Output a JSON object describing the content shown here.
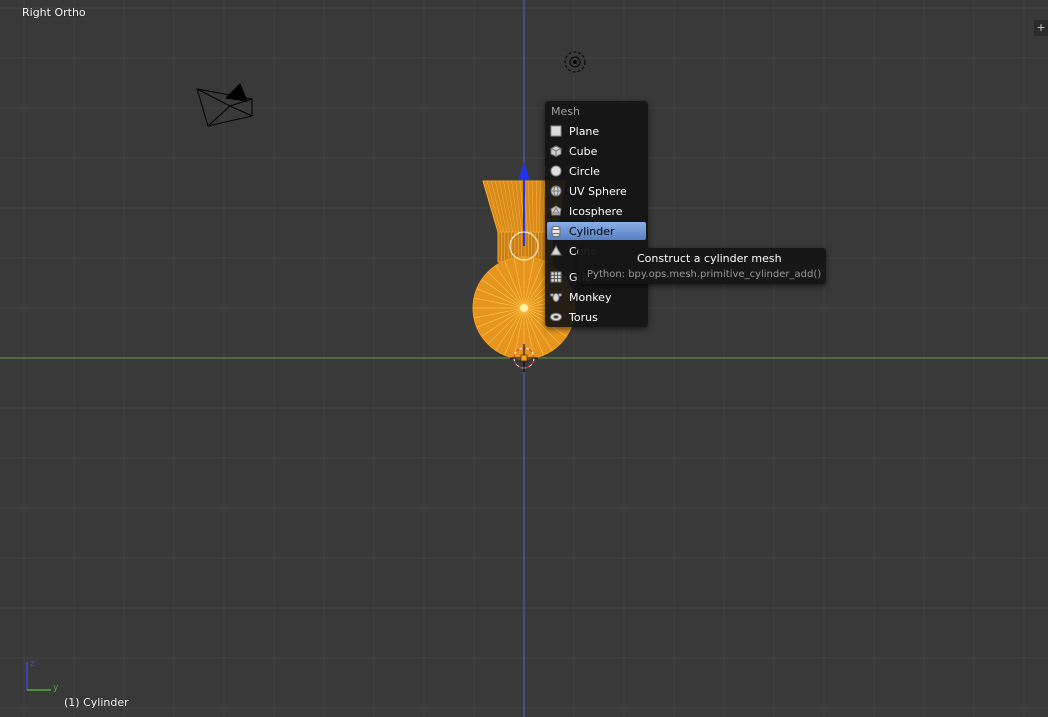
{
  "viewport": {
    "view_label": "Right Ortho",
    "object_info": "(1) Cylinder",
    "corner_widget": "+",
    "axis_labels": {
      "y": "y",
      "z": "z"
    }
  },
  "menu": {
    "title": "Mesh",
    "items": [
      {
        "label": "Plane",
        "icon": "plane-icon",
        "active": false
      },
      {
        "label": "Cube",
        "icon": "cube-icon",
        "active": false
      },
      {
        "label": "Circle",
        "icon": "circle-icon",
        "active": false
      },
      {
        "label": "UV Sphere",
        "icon": "uv-sphere-icon",
        "active": false
      },
      {
        "label": "Icosphere",
        "icon": "icosphere-icon",
        "active": false
      },
      {
        "label": "Cylinder",
        "icon": "cylinder-icon",
        "active": true
      },
      {
        "label": "Cone",
        "icon": "cone-icon",
        "active": false
      },
      {
        "label": "Grid",
        "icon": "grid-icon",
        "active": false
      },
      {
        "label": "Monkey",
        "icon": "monkey-icon",
        "active": false
      },
      {
        "label": "Torus",
        "icon": "torus-icon",
        "active": false
      }
    ]
  },
  "tooltip": {
    "title": "Construct a cylinder mesh",
    "python": "Python: bpy.ops.mesh.primitive_cylinder_add()"
  },
  "colors": {
    "background": "#393939",
    "selection_orange": "#f5a21b",
    "axis_green": "#5e9a3a",
    "axis_blue": "#4a62d8",
    "menu_highlight": "#5680c2"
  }
}
